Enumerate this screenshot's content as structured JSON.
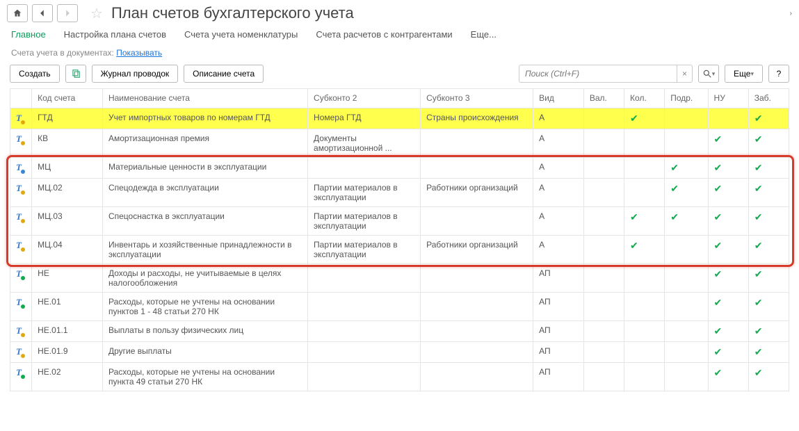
{
  "header": {
    "title": "План счетов бухгалтерского учета"
  },
  "tabs": [
    {
      "label": "Главное",
      "active": true
    },
    {
      "label": "Настройка плана счетов",
      "active": false
    },
    {
      "label": "Счета учета номенклатуры",
      "active": false
    },
    {
      "label": "Счета расчетов с контрагентами",
      "active": false
    },
    {
      "label": "Еще...",
      "active": false
    }
  ],
  "status_line": {
    "label": "Счета учета в документах:",
    "link": "Показывать"
  },
  "toolbar": {
    "create": "Создать",
    "journal": "Журнал проводок",
    "descr": "Описание счета",
    "search_placeholder": "Поиск (Ctrl+F)",
    "more": "Еще"
  },
  "columns": {
    "code": "Код счета",
    "name": "Наименование счета",
    "sub2": "Субконто 2",
    "sub3": "Субконто 3",
    "vid": "Вид",
    "val": "Вал.",
    "kol": "Кол.",
    "podr": "Подр.",
    "nu": "НУ",
    "zab": "Заб."
  },
  "rows": [
    {
      "icon": "t-yellow",
      "code": "ГТД",
      "name": "Учет импортных товаров по номерам ГТД",
      "sub2": "Номера ГТД",
      "sub3": "Страны происхождения",
      "vid": "А",
      "kol": true,
      "zab": true,
      "selected": true
    },
    {
      "icon": "t-yellow",
      "code": "КВ",
      "name": "Амортизационная премия",
      "sub2": "Документы амортизационной ...",
      "sub3": "",
      "vid": "А",
      "nu": true,
      "zab": true
    },
    {
      "icon": "t-blue",
      "code": "МЦ",
      "name": "Материальные ценности в эксплуатации",
      "sub2": "",
      "sub3": "",
      "vid": "А",
      "podr": true,
      "nu": true,
      "zab": true,
      "group": true
    },
    {
      "icon": "t-yellow",
      "code": "МЦ.02",
      "name": "Спецодежда в эксплуатации",
      "sub2": "Партии материалов в эксплуатации",
      "sub3": "Работники организаций",
      "vid": "А",
      "podr": true,
      "nu": true,
      "zab": true,
      "group": true
    },
    {
      "icon": "t-yellow",
      "code": "МЦ.03",
      "name": "Спецоснастка в эксплуатации",
      "sub2": "Партии материалов в эксплуатации",
      "sub3": "",
      "vid": "А",
      "kol": true,
      "podr": true,
      "nu": true,
      "zab": true,
      "group": true
    },
    {
      "icon": "t-yellow",
      "code": "МЦ.04",
      "name": "Инвентарь и хозяйственные принадлежности в эксплуатации",
      "sub2": "Партии материалов в эксплуатации",
      "sub3": "Работники организаций",
      "vid": "А",
      "kol": true,
      "nu": true,
      "zab": true,
      "group": true
    },
    {
      "icon": "t-green",
      "code": "НЕ",
      "name": "Доходы и расходы, не учитываемые в целях налогообложения",
      "sub2": "",
      "sub3": "",
      "vid": "АП",
      "nu": true,
      "zab": true
    },
    {
      "icon": "t-green",
      "code": "НЕ.01",
      "name": "Расходы, которые не учтены на основании пунктов 1 - 48 статьи 270 НК",
      "sub2": "",
      "sub3": "",
      "vid": "АП",
      "nu": true,
      "zab": true
    },
    {
      "icon": "t-yellow",
      "code": "НЕ.01.1",
      "name": "Выплаты в пользу физических лиц",
      "sub2": "",
      "sub3": "",
      "vid": "АП",
      "nu": true,
      "zab": true
    },
    {
      "icon": "t-yellow",
      "code": "НЕ.01.9",
      "name": "Другие выплаты",
      "sub2": "",
      "sub3": "",
      "vid": "АП",
      "nu": true,
      "zab": true
    },
    {
      "icon": "t-green",
      "code": "НЕ.02",
      "name": "Расходы, которые не учтены на основании пункта 49 статьи 270 НК",
      "sub2": "",
      "sub3": "",
      "vid": "АП",
      "nu": true,
      "zab": true
    }
  ]
}
